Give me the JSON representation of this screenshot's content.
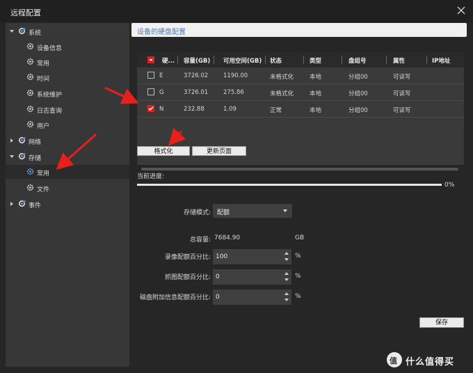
{
  "window": {
    "title": "远程配置"
  },
  "sidebar": {
    "items": [
      {
        "label": "系统",
        "level": 0,
        "state": "expanded"
      },
      {
        "label": "设备信息",
        "level": 1
      },
      {
        "label": "常用",
        "level": 1
      },
      {
        "label": "时间",
        "level": 1
      },
      {
        "label": "系统维护",
        "level": 1
      },
      {
        "label": "日志查询",
        "level": 1
      },
      {
        "label": "用户",
        "level": 1
      },
      {
        "label": "网络",
        "level": 0,
        "state": "collapsed"
      },
      {
        "label": "存储",
        "level": 0,
        "state": "expanded"
      },
      {
        "label": "常用",
        "level": 1,
        "selected": true
      },
      {
        "label": "文件",
        "level": 1
      },
      {
        "label": "事件",
        "level": 0,
        "state": "collapsed"
      }
    ]
  },
  "section": {
    "title": "设备的硬盘配置"
  },
  "disk_table": {
    "columns": [
      "硬...",
      "容量(GB)",
      "可用空间(GB)",
      "状态",
      "类型",
      "盘组号",
      "属性",
      "IP地址"
    ],
    "rows": [
      {
        "checked": false,
        "disk": "E",
        "capacity": "3726.02",
        "free": "1190.00",
        "status": "未格式化",
        "type": "本地",
        "group": "分组00",
        "attr": "可读写",
        "ip": ""
      },
      {
        "checked": false,
        "disk": "G",
        "capacity": "3726.01",
        "free": "275.86",
        "status": "未格式化",
        "type": "本地",
        "group": "分组00",
        "attr": "可读写",
        "ip": ""
      },
      {
        "checked": true,
        "disk": "N",
        "capacity": "232.88",
        "free": "1.09",
        "status": "正常",
        "type": "本地",
        "group": "分组00",
        "attr": "可读写",
        "ip": ""
      }
    ]
  },
  "actions": {
    "format_label": "格式化",
    "refresh_label": "更新页面"
  },
  "progress": {
    "label": "当前进度:",
    "percent_text": "0%",
    "fraction": 0
  },
  "storage_form": {
    "mode_label": "存储模式:",
    "mode_value": "配额",
    "total_label": "总容量:",
    "total_value": "7684.90",
    "total_unit": "GB",
    "record_label": "录像配额百分比:",
    "record_value": "100",
    "capture_label": "抓图配额百分比:",
    "capture_value": "0",
    "extra_label": "磁盘附加信息配额百分比:",
    "extra_value": "0",
    "percent_unit": "%"
  },
  "save_label": "保存",
  "watermark": {
    "badge": "值",
    "text": "什么值得买"
  },
  "colors": {
    "accent_red": "#e02020",
    "title_blue": "#4a7bb3"
  }
}
